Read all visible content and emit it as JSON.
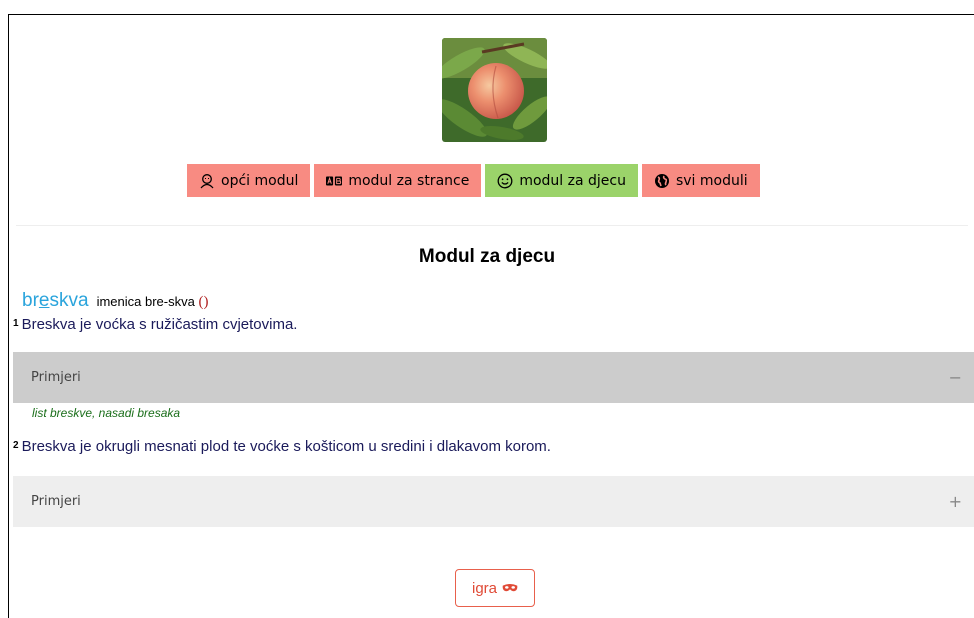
{
  "header": {
    "image_icon": "peach-photo",
    "modules": [
      {
        "label": "opći modul",
        "icon": "person-icon",
        "color": "#f88b82"
      },
      {
        "label": "modul za strance",
        "icon": "ab-translate-icon",
        "color": "#f88b82"
      },
      {
        "label": "modul za djecu",
        "icon": "smiley-icon",
        "color": "#9bd36a"
      },
      {
        "label": "svi moduli",
        "icon": "globe-icon",
        "color": "#f88b82"
      }
    ]
  },
  "main": {
    "title": "Modul za djecu",
    "entry": {
      "headword_start": "br",
      "headword_stressed": "e",
      "headword_end": "skva",
      "pos": "imenica bre-skva",
      "paren": "()"
    },
    "senses": [
      {
        "number": "1",
        "definition": "Breskva je voćka s ružičastim cvjetovima.",
        "examples_label": "Primjeri",
        "toggle": "−",
        "expanded": true,
        "examples": "list breskve, nasadi bresaka"
      },
      {
        "number": "2",
        "definition": "Breskva je okrugli mesnati plod te voćke s košticom u sredini i dlakavom korom.",
        "examples_label": "Primjeri",
        "toggle": "+",
        "expanded": false
      }
    ]
  },
  "footer": {
    "game_label": "igra",
    "game_icon": "mask-icon"
  },
  "colors": {
    "accent_red": "#f88b82",
    "accent_green": "#9bd36a",
    "headword": "#2aa4dc",
    "game": "#e04a36"
  }
}
